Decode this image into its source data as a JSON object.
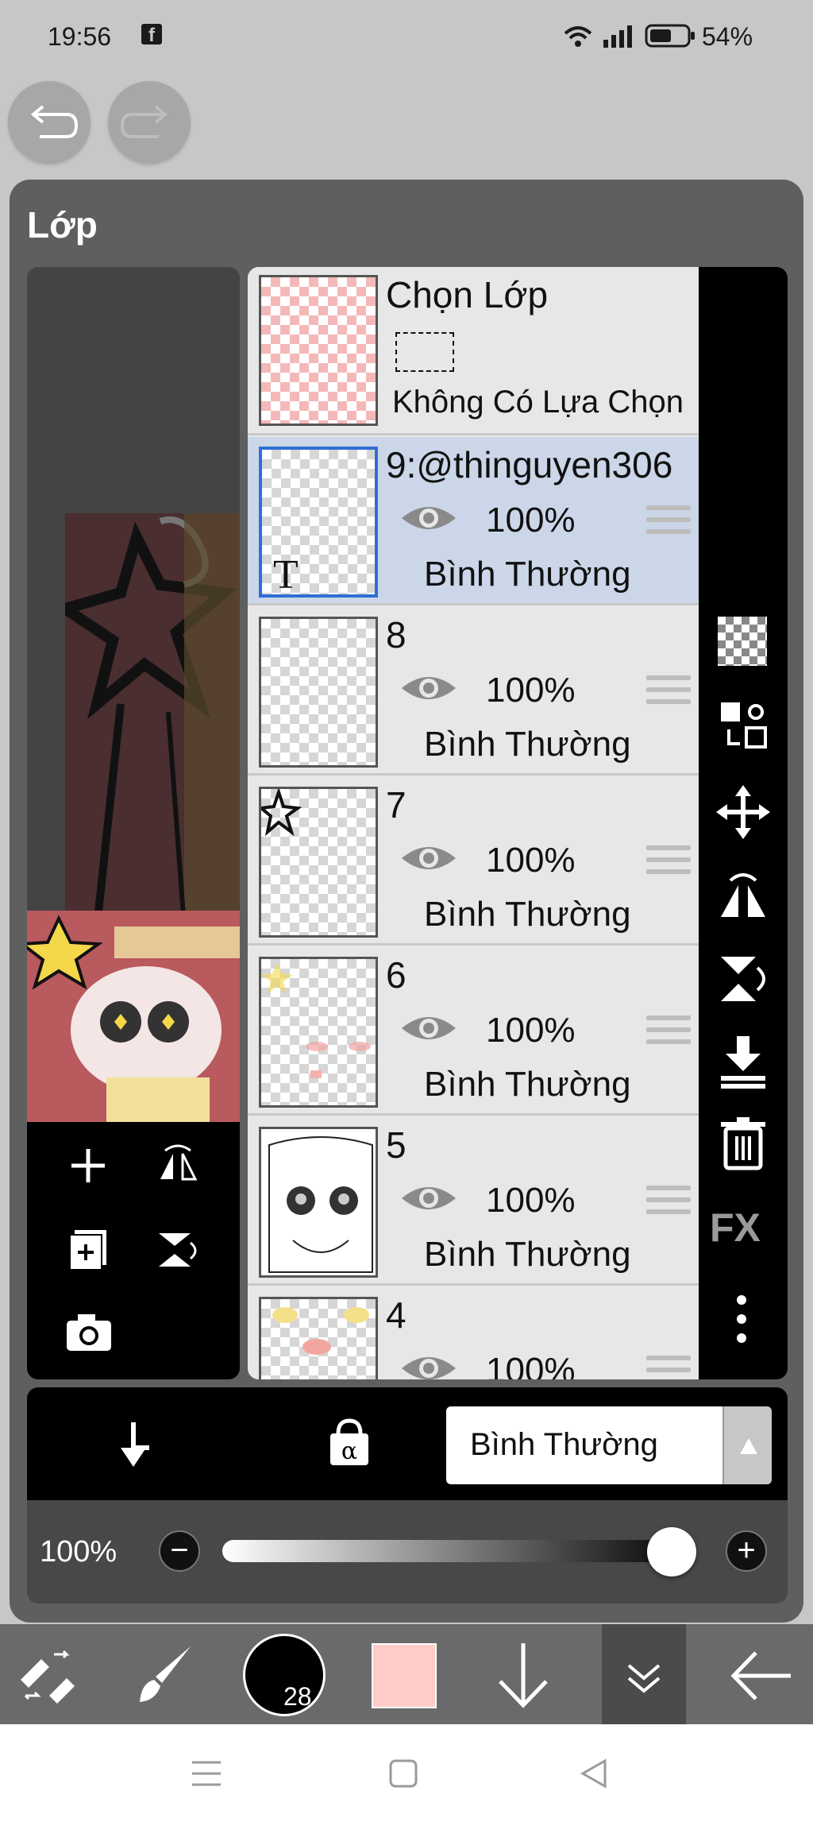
{
  "status_bar": {
    "time": "19:56",
    "battery": "54%"
  },
  "panel": {
    "title": "Lớp"
  },
  "selection_layer": {
    "title": "Chọn Lớp",
    "subtitle": "Không Có Lựa Chọn"
  },
  "layers": [
    {
      "name": "9:@thinguyen306",
      "opacity": "100%",
      "blend": "Bình Thường",
      "selected": true,
      "text_icon": "T"
    },
    {
      "name": "8",
      "opacity": "100%",
      "blend": "Bình Thường",
      "selected": false
    },
    {
      "name": "7",
      "opacity": "100%",
      "blend": "Bình Thường",
      "selected": false
    },
    {
      "name": "6",
      "opacity": "100%",
      "blend": "Bình Thường",
      "selected": false
    },
    {
      "name": "5",
      "opacity": "100%",
      "blend": "Bình Thường",
      "selected": false
    },
    {
      "name": "4",
      "opacity": "100%",
      "blend": "",
      "selected": false
    }
  ],
  "right_tools": {
    "fx_label": "FX"
  },
  "blend_mode": {
    "label": "Bình Thường"
  },
  "opacity_bar": {
    "value_label": "100%",
    "value": 1.0
  },
  "toolbar": {
    "brush_size": "28",
    "color": "#ffccc8"
  },
  "colors": {
    "selected_layer": "#cbd6e8",
    "selection_border": "#2e6fd6",
    "panel": "#5f5f5f"
  }
}
